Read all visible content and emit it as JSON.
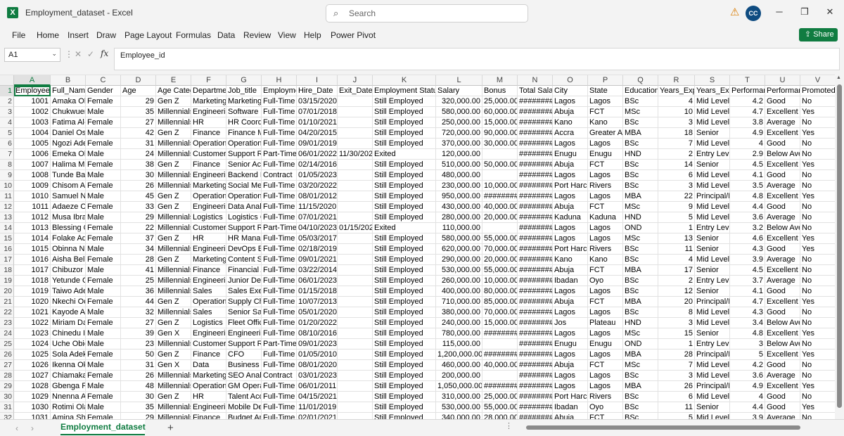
{
  "window": {
    "title": "Employment_dataset  -  Excel",
    "app_icon": "X",
    "search_placeholder": "Search",
    "user_initials": "CC",
    "icons": [
      "excel-icon",
      "search-icon",
      "warning-icon",
      "minimize-icon",
      "restore-icon",
      "close-icon"
    ]
  },
  "menu": [
    "File",
    "Home",
    "Insert",
    "Draw",
    "Page Layout",
    "Formulas",
    "Data",
    "Review",
    "View",
    "Help",
    "Power Pivot"
  ],
  "share_label": "Share",
  "formula_bar": {
    "name_box": "A1",
    "fx": "fx",
    "content": "Employee_id"
  },
  "columns": [
    "A",
    "B",
    "C",
    "D",
    "E",
    "F",
    "G",
    "H",
    "I",
    "J",
    "K",
    "L",
    "M",
    "N",
    "O",
    "P",
    "Q",
    "R",
    "S",
    "T",
    "U",
    "V"
  ],
  "row_numbers": [
    "1",
    "2",
    "3",
    "4",
    "5",
    "6",
    "7",
    "8",
    "9",
    "10",
    "11",
    "12",
    "13",
    "14",
    "15",
    "16",
    "17",
    "18",
    "19",
    "20",
    "21",
    "22",
    "23",
    "24",
    "25",
    "26",
    "27",
    "28",
    "29",
    "30",
    "31",
    "32"
  ],
  "rows": [
    [
      "Employee_",
      "Full_Name",
      "Gender",
      "Age",
      "Age Catego",
      "Departmen",
      "Job_title",
      "Employme",
      "Hire_Date",
      "Exit_Date",
      "Employment Status",
      "Salary",
      "Bonus",
      "Total Salar",
      "City",
      "State",
      "Education_",
      "Years_Expe",
      "Years_Expe",
      "Performan",
      "Performan",
      "Promoted"
    ],
    [
      "1001",
      "Amaka Oko",
      "Female",
      "29",
      "Gen Z",
      "Marketing",
      "Marketing_",
      "Full-Time",
      "03/15/2020",
      "",
      "Still Employed",
      "320,000.00",
      "25,000.00",
      "########",
      "Lagos",
      "Lagos",
      "BSc",
      "4",
      "Mid Level",
      "4.2",
      "Good",
      "No"
    ],
    [
      "1002",
      "Chukwuem",
      "Male",
      "35",
      "Millennials",
      "Engineerin",
      "Software E",
      "Full-Time",
      "07/01/2018",
      "",
      "Still Employed",
      "580,000.00",
      "60,000.00",
      "########",
      "Abuja",
      "FCT",
      "MSc",
      "10",
      "Mid Level",
      "4.7",
      "Excellent",
      "Yes"
    ],
    [
      "1003",
      "Fatima Al-I",
      "Female",
      "27",
      "Millennials",
      "HR",
      "HR Coordi",
      "Full-Time",
      "01/10/2021",
      "",
      "Still Employed",
      "250,000.00",
      "15,000.00",
      "########",
      "Kano",
      "Kano",
      "BSc",
      "3",
      "Mid Level",
      "3.8",
      "Average",
      "No"
    ],
    [
      "1004",
      "Daniel Ose",
      "Male",
      "42",
      "Gen Z",
      "Finance",
      "Finance M",
      "Full-Time",
      "04/20/2015",
      "",
      "Still Employed",
      "720,000.00",
      "90,000.00",
      "########",
      "Accra",
      "Greater Ac",
      "MBA",
      "18",
      "Senior",
      "4.9",
      "Excellent",
      "Yes"
    ],
    [
      "1005",
      "Ngozi Adey",
      "Female",
      "31",
      "Millennials",
      "Operation",
      "Operation",
      "Full-Time",
      "09/01/2019",
      "",
      "Still Employed",
      "370,000.00",
      "30,000.00",
      "########",
      "Lagos",
      "Lagos",
      "BSc",
      "7",
      "Mid Level",
      "4",
      "Good",
      "No"
    ],
    [
      "1006",
      "Emeka Obi",
      "Male",
      "24",
      "Millennials",
      "Customer S",
      "Support Re",
      "Part-Time",
      "06/01/2022",
      "11/30/202",
      "Exited",
      "120,000.00",
      "",
      "########",
      "Enugu",
      "Enugu",
      "HND",
      "2",
      "Entry Level",
      "2.9",
      "Below Ave",
      "No"
    ],
    [
      "1007",
      "Halima Mu",
      "Female",
      "38",
      "Gen Z",
      "Finance",
      "Senior Acc",
      "Full-Time",
      "02/14/2016",
      "",
      "Still Employed",
      "510,000.00",
      "50,000.00",
      "########",
      "Abuja",
      "FCT",
      "BSc",
      "14",
      "Senior",
      "4.5",
      "Excellent",
      "Yes"
    ],
    [
      "1008",
      "Tunde Bak",
      "Male",
      "30",
      "Millennials",
      "Engineerin",
      "Backend D",
      "Contract",
      "01/05/2023",
      "",
      "Still Employed",
      "480,000.00",
      "",
      "########",
      "Lagos",
      "Lagos",
      "BSc",
      "6",
      "Mid Level",
      "4.1",
      "Good",
      "No"
    ],
    [
      "1009",
      "Chisom Ag",
      "Female",
      "26",
      "Millennials",
      "Marketing",
      "Social Med",
      "Full-Time",
      "03/20/2022",
      "",
      "Still Employed",
      "230,000.00",
      "10,000.00",
      "########",
      "Port Harco",
      "Rivers",
      "BSc",
      "3",
      "Mid Level",
      "3.5",
      "Average",
      "No"
    ],
    [
      "1010",
      "Samuel Nw",
      "Male",
      "45",
      "Gen Z",
      "Operation",
      "Operation",
      "Full-Time",
      "08/01/2012",
      "",
      "Still Employed",
      "950,000.00",
      "########",
      "########",
      "Lagos",
      "Lagos",
      "MBA",
      "22",
      "Principal/L",
      "4.8",
      "Excellent",
      "Yes"
    ],
    [
      "1011",
      "Adaeze Ch",
      "Female",
      "33",
      "Gen Z",
      "Engineerin",
      "Data Analy",
      "Full-Time",
      "11/15/2020",
      "",
      "Still Employed",
      "430,000.00",
      "40,000.00",
      "########",
      "Abuja",
      "FCT",
      "MSc",
      "9",
      "Mid Level",
      "4.4",
      "Good",
      "No"
    ],
    [
      "1012",
      "Musa Ibrah",
      "Male",
      "29",
      "Millennials",
      "Logistics",
      "Logistics C",
      "Full-Time",
      "07/01/2021",
      "",
      "Still Employed",
      "280,000.00",
      "20,000.00",
      "########",
      "Kaduna",
      "Kaduna",
      "HND",
      "5",
      "Mid Level",
      "3.6",
      "Average",
      "No"
    ],
    [
      "1013",
      "Blessing O",
      "Female",
      "22",
      "Millennials",
      "Customer S",
      "Support Re",
      "Part-Time",
      "04/10/2023",
      "01/15/202",
      "Exited",
      "110,000.00",
      "",
      "########",
      "Lagos",
      "Lagos",
      "OND",
      "1",
      "Entry Level",
      "3.2",
      "Below Ave",
      "No"
    ],
    [
      "1014",
      "Folake Ade",
      "Female",
      "37",
      "Gen Z",
      "HR",
      "HR Manag",
      "Full-Time",
      "05/03/2017",
      "",
      "Still Employed",
      "580,000.00",
      "55,000.00",
      "########",
      "Lagos",
      "Lagos",
      "MSc",
      "13",
      "Senior",
      "4.6",
      "Excellent",
      "Yes"
    ],
    [
      "1015",
      "Obinna Nk",
      "Male",
      "34",
      "Millennials",
      "Engineerin",
      "DevOps En",
      "Full-Time",
      "02/18/2019",
      "",
      "Still Employed",
      "620,000.00",
      "70,000.00",
      "########",
      "Port Harco",
      "Rivers",
      "BSc",
      "11",
      "Senior",
      "4.3",
      "Good",
      "Yes"
    ],
    [
      "1016",
      "Aisha Bello",
      "Female",
      "28",
      "Gen Z",
      "Marketing",
      "Content St",
      "Full-Time",
      "09/01/2021",
      "",
      "Still Employed",
      "290,000.00",
      "20,000.00",
      "########",
      "Kano",
      "Kano",
      "BSc",
      "4",
      "Mid Level",
      "3.9",
      "Average",
      "No"
    ],
    [
      "1017",
      "Chibuzor C",
      "Male",
      "41",
      "Millennials",
      "Finance",
      "Financial A",
      "Full-Time",
      "03/22/2014",
      "",
      "Still Employed",
      "530,000.00",
      "55,000.00",
      "########",
      "Abuja",
      "FCT",
      "MBA",
      "17",
      "Senior",
      "4.5",
      "Excellent",
      "No"
    ],
    [
      "1018",
      "Yetunde O",
      "Female",
      "25",
      "Millennials",
      "Engineerin",
      "Junior Dev",
      "Full-Time",
      "06/01/2023",
      "",
      "Still Employed",
      "260,000.00",
      "10,000.00",
      "########",
      "Ibadan",
      "Oyo",
      "BSc",
      "2",
      "Entry Level",
      "3.7",
      "Average",
      "No"
    ],
    [
      "1019",
      "Taiwo Adel",
      "Male",
      "36",
      "Millennials",
      "Sales",
      "Sales Exec",
      "Full-Time",
      "01/15/2018",
      "",
      "Still Employed",
      "400,000.00",
      "80,000.00",
      "########",
      "Lagos",
      "Lagos",
      "BSc",
      "12",
      "Senior",
      "4.1",
      "Good",
      "No"
    ],
    [
      "1020",
      "Nkechi Od",
      "Female",
      "44",
      "Gen Z",
      "Operation",
      "Supply Cha",
      "Full-Time",
      "10/07/2013",
      "",
      "Still Employed",
      "710,000.00",
      "85,000.00",
      "########",
      "Abuja",
      "FCT",
      "MBA",
      "20",
      "Principal/L",
      "4.7",
      "Excellent",
      "Yes"
    ],
    [
      "1021",
      "Kayode Ad",
      "Male",
      "32",
      "Millennials",
      "Sales",
      "Senior Sale",
      "Full-Time",
      "05/01/2020",
      "",
      "Still Employed",
      "380,000.00",
      "70,000.00",
      "########",
      "Lagos",
      "Lagos",
      "BSc",
      "8",
      "Mid Level",
      "4.3",
      "Good",
      "No"
    ],
    [
      "1022",
      "Miriam Dar",
      "Female",
      "27",
      "Gen Z",
      "Logistics",
      "Fleet Offic",
      "Full-Time",
      "01/20/2022",
      "",
      "Still Employed",
      "240,000.00",
      "15,000.00",
      "########",
      "Jos",
      "Plateau",
      "HND",
      "3",
      "Mid Level",
      "3.4",
      "Below Ave",
      "No"
    ],
    [
      "1023",
      "Chinedu Ih",
      "Male",
      "39",
      "Gen X",
      "Engineerin",
      "Engineerin",
      "Full-Time",
      "08/10/2016",
      "",
      "Still Employed",
      "780,000.00",
      "########",
      "########",
      "Lagos",
      "Lagos",
      "MSc",
      "15",
      "Senior",
      "4.8",
      "Excellent",
      "Yes"
    ],
    [
      "1024",
      "Uche Obio",
      "Male",
      "23",
      "Millennials",
      "Customer S",
      "Support Re",
      "Part-Time",
      "09/01/2023",
      "",
      "Still Employed",
      "115,000.00",
      "",
      "########",
      "Enugu",
      "Enugu",
      "OND",
      "1",
      "Entry Level",
      "3",
      "Below Ave",
      "No"
    ],
    [
      "1025",
      "Sola Adeku",
      "Female",
      "50",
      "Gen Z",
      "Finance",
      "CFO",
      "Full-Time",
      "01/05/2010",
      "",
      "Still Employed",
      "1,200,000.00",
      "########",
      "########",
      "Lagos",
      "Lagos",
      "MBA",
      "28",
      "Principal/L",
      "5",
      "Excellent",
      "Yes"
    ],
    [
      "1026",
      "Ikenna Oka",
      "Male",
      "31",
      "Gen X",
      "Data",
      "Business In",
      "Full-Time",
      "08/01/2020",
      "",
      "Still Employed",
      "460,000.00",
      "40,000.00",
      "########",
      "Abuja",
      "FCT",
      "MSc",
      "7",
      "Mid Level",
      "4.2",
      "Good",
      "No"
    ],
    [
      "1027",
      "Chiamaka",
      "Female",
      "26",
      "Millennials",
      "Marketing",
      "SEO Analys",
      "Contract",
      "03/01/2023",
      "",
      "Still Employed",
      "200,000.00",
      "",
      "########",
      "Lagos",
      "Lagos",
      "BSc",
      "3",
      "Mid Level",
      "3.6",
      "Average",
      "No"
    ],
    [
      "1028",
      "Gbenga Fa",
      "Male",
      "48",
      "Millennials",
      "Operation",
      "GM Operat",
      "Full-Time",
      "06/01/2011",
      "",
      "Still Employed",
      "1,050,000.00",
      "########",
      "########",
      "Lagos",
      "Lagos",
      "MBA",
      "26",
      "Principal/L",
      "4.9",
      "Excellent",
      "Yes"
    ],
    [
      "1029",
      "Nnenna Ag",
      "Female",
      "30",
      "Gen Z",
      "HR",
      "Talent Acq",
      "Full-Time",
      "04/15/2021",
      "",
      "Still Employed",
      "310,000.00",
      "25,000.00",
      "########",
      "Port Harco",
      "Rivers",
      "BSc",
      "6",
      "Mid Level",
      "4",
      "Good",
      "No"
    ],
    [
      "1030",
      "Rotimi Ola",
      "Male",
      "35",
      "Millennials",
      "Engineerin",
      "Mobile Dev",
      "Full-Time",
      "11/01/2019",
      "",
      "Still Employed",
      "530,000.00",
      "55,000.00",
      "########",
      "Ibadan",
      "Oyo",
      "BSc",
      "11",
      "Senior",
      "4.4",
      "Good",
      "Yes"
    ],
    [
      "1031",
      "Amina She",
      "Female",
      "29",
      "Millennials",
      "Finance",
      "Budget An",
      "Full-Time",
      "02/01/2021",
      "",
      "Still Employed",
      "340,000.00",
      "28,000.00",
      "########",
      "Abuja",
      "FCT",
      "BSc",
      "5",
      "Mid Level",
      "3.9",
      "Average",
      "No"
    ]
  ],
  "sheet_tab": "Employment_dataset",
  "add_sheet": "+"
}
